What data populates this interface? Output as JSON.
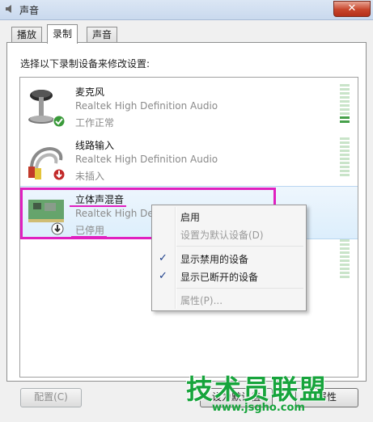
{
  "window": {
    "title": "声音",
    "close_symbol": "✕"
  },
  "tabs": [
    {
      "label": "播放",
      "active": false
    },
    {
      "label": "录制",
      "active": true
    },
    {
      "label": "声音",
      "active": false
    }
  ],
  "instruction": "选择以下录制设备来修改设置:",
  "devices": [
    {
      "name": "麦克风",
      "driver": "Realtek High Definition Audio",
      "status": "工作正常",
      "icon": "microphone-icon",
      "badge": "check-badge-icon"
    },
    {
      "name": "线路输入",
      "driver": "Realtek High Definition Audio",
      "status": "未插入",
      "icon": "line-in-cable-icon",
      "badge": "unplugged-arrow-icon"
    },
    {
      "name": "立体声混音",
      "driver": "Realtek High Def",
      "status": "已停用",
      "icon": "sound-card-icon",
      "badge": "disabled-arrow-icon"
    }
  ],
  "context_menu": {
    "items": [
      {
        "label": "启用",
        "disabled": false,
        "checked": false
      },
      {
        "label": "设置为默认设备(D)",
        "disabled": true,
        "checked": false
      },
      {
        "label": "显示禁用的设备",
        "disabled": false,
        "checked": true
      },
      {
        "label": "显示已断开的设备",
        "disabled": false,
        "checked": true
      },
      {
        "label": "属性(P)...",
        "disabled": true,
        "checked": false
      }
    ]
  },
  "buttons": {
    "configure": "配置(C)",
    "set_default": "设为默认值",
    "properties": "属性"
  },
  "watermark": {
    "text": "技术员联盟",
    "url": "www.jsgho.com"
  },
  "colors": {
    "annotation": "#e020c0",
    "meter_on": "#46a04a",
    "watermark": "#17a43c"
  }
}
